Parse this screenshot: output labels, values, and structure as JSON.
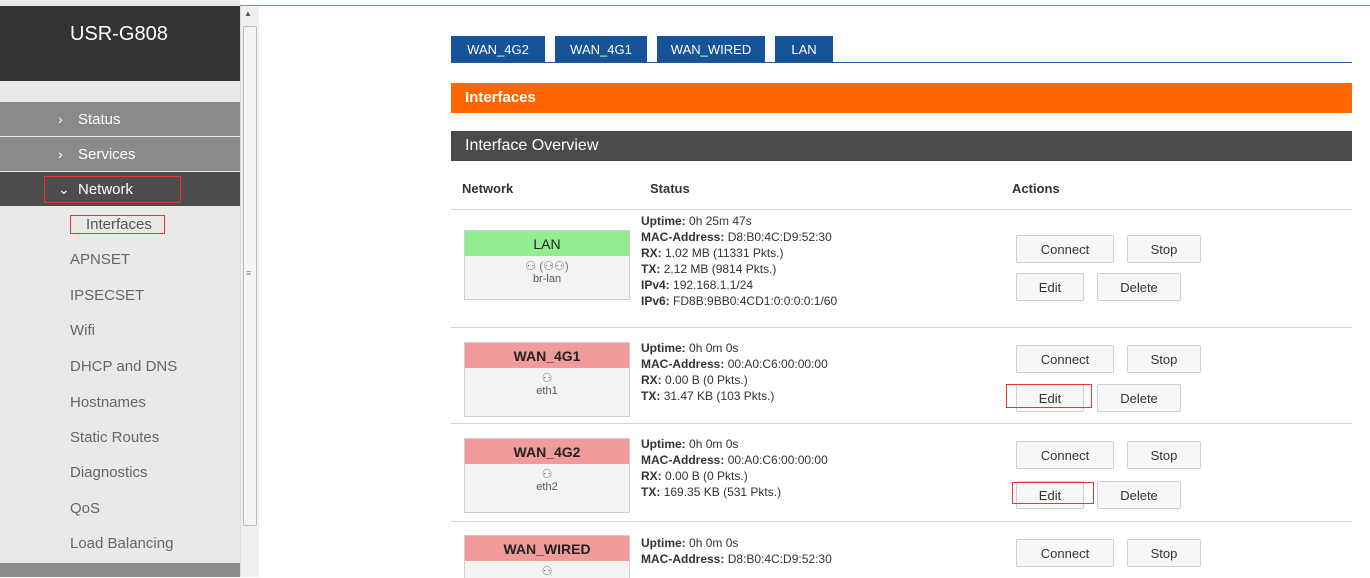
{
  "brand": "USR-G808",
  "sidebar": {
    "items": [
      {
        "label": "Status"
      },
      {
        "label": "Services"
      },
      {
        "label": "Network"
      }
    ],
    "subitems": [
      "Interfaces",
      "APNSET",
      "IPSECSET",
      "Wifi",
      "DHCP and DNS",
      "Hostnames",
      "Static Routes",
      "Diagnostics",
      "QoS",
      "Load Balancing"
    ]
  },
  "tabs": [
    "WAN_4G2",
    "WAN_4G1",
    "WAN_WIRED",
    "LAN"
  ],
  "section_title": "Interfaces",
  "overview_title": "Interface Overview",
  "table": {
    "headers": {
      "network": "Network",
      "status": "Status",
      "actions": "Actions"
    },
    "rows": [
      {
        "name": "LAN",
        "device": "br-lan",
        "uptime": "0h 25m 47s",
        "mac": "D8:B0:4C:D9:52:30",
        "rx": "1.02 MB (11331 Pkts.)",
        "tx": "2.12 MB (9814 Pkts.)",
        "ipv4": "192.168.1.1/24",
        "ipv6": "FD8B:9BB0:4CD1:0:0:0:0:1/60"
      },
      {
        "name": "WAN_4G1",
        "device": "eth1",
        "uptime": "0h 0m 0s",
        "mac": "00:A0:C6:00:00:00",
        "rx": "0.00 B (0 Pkts.)",
        "tx": "31.47 KB (103 Pkts.)"
      },
      {
        "name": "WAN_4G2",
        "device": "eth2",
        "uptime": "0h 0m 0s",
        "mac": "00:A0:C6:00:00:00",
        "rx": "0.00 B (0 Pkts.)",
        "tx": "169.35 KB (531 Pkts.)"
      },
      {
        "name": "WAN_WIRED",
        "uptime": "0h 0m 0s",
        "mac": "D8:B0:4C:D9:52:30"
      }
    ]
  },
  "labels": {
    "uptime": "Uptime:",
    "mac": "MAC-Address:",
    "rx": "RX:",
    "tx": "TX:",
    "ipv4": "IPv4:",
    "ipv6": "IPv6:"
  },
  "buttons": {
    "connect": "Connect",
    "stop": "Stop",
    "edit": "Edit",
    "delete": "Delete"
  },
  "colors": {
    "accent": "#ff6600",
    "tab_blue": "#175397",
    "up_green": "#90ee90",
    "down_red": "#f09a9a"
  }
}
